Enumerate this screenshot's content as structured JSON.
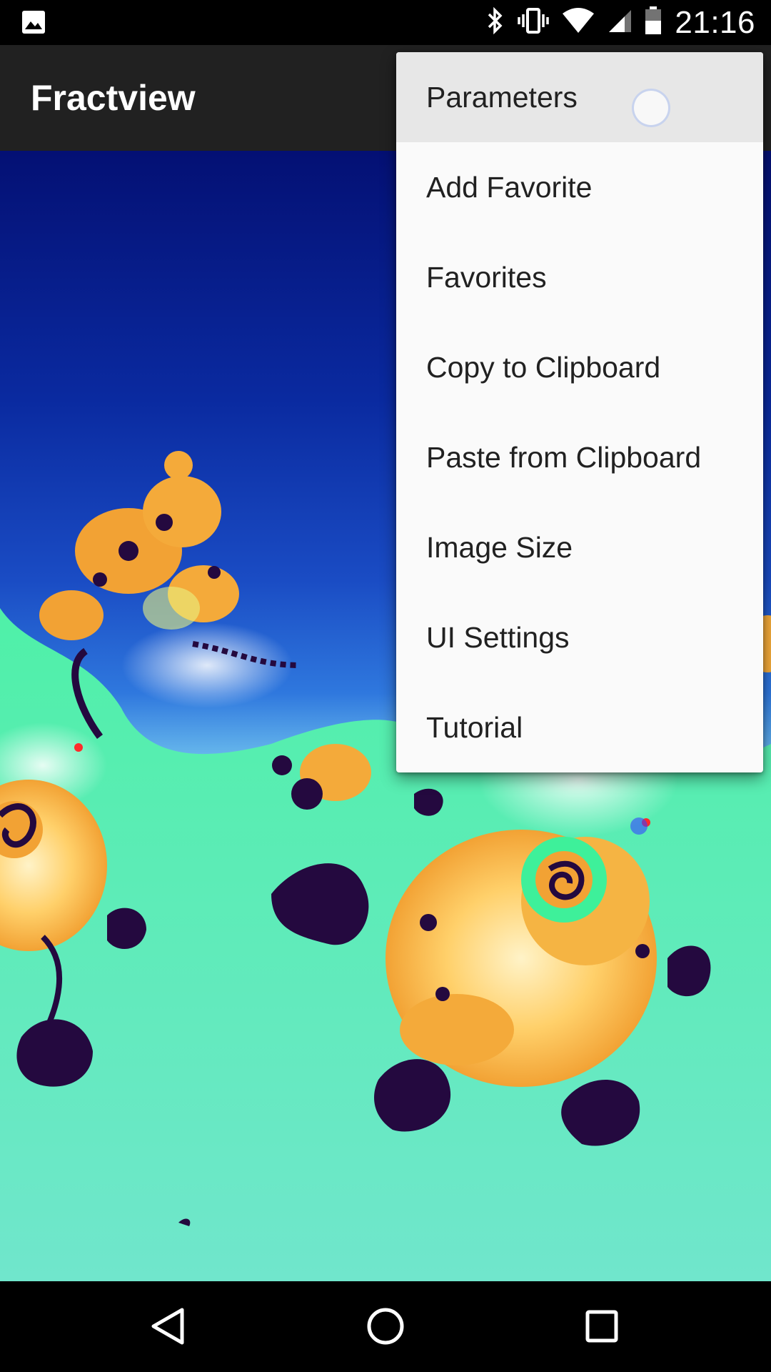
{
  "status_bar": {
    "time": "21:16",
    "icons": [
      "image-icon",
      "bluetooth-icon",
      "vibrate-icon",
      "wifi-icon",
      "signal-icon",
      "battery-icon"
    ]
  },
  "app_bar": {
    "title": "Fractview"
  },
  "overflow_menu": {
    "items": [
      {
        "label": "Parameters",
        "pressed": true
      },
      {
        "label": "Add Favorite"
      },
      {
        "label": "Favorites"
      },
      {
        "label": "Copy to Clipboard"
      },
      {
        "label": "Paste from Clipboard"
      },
      {
        "label": "Image Size"
      },
      {
        "label": "UI Settings"
      },
      {
        "label": "Tutorial"
      }
    ]
  },
  "nav_bar": {
    "icons": [
      "back-icon",
      "home-icon",
      "recents-icon"
    ]
  },
  "colors": {
    "app_bar": "#212121",
    "menu_bg": "#fafafa",
    "menu_pressed": "#e7e7e7",
    "fractal_deep_blue": "#041074",
    "fractal_orange": "#f4a93a",
    "fractal_green": "#72e9c8",
    "fractal_dark_purple": "#24093f"
  }
}
